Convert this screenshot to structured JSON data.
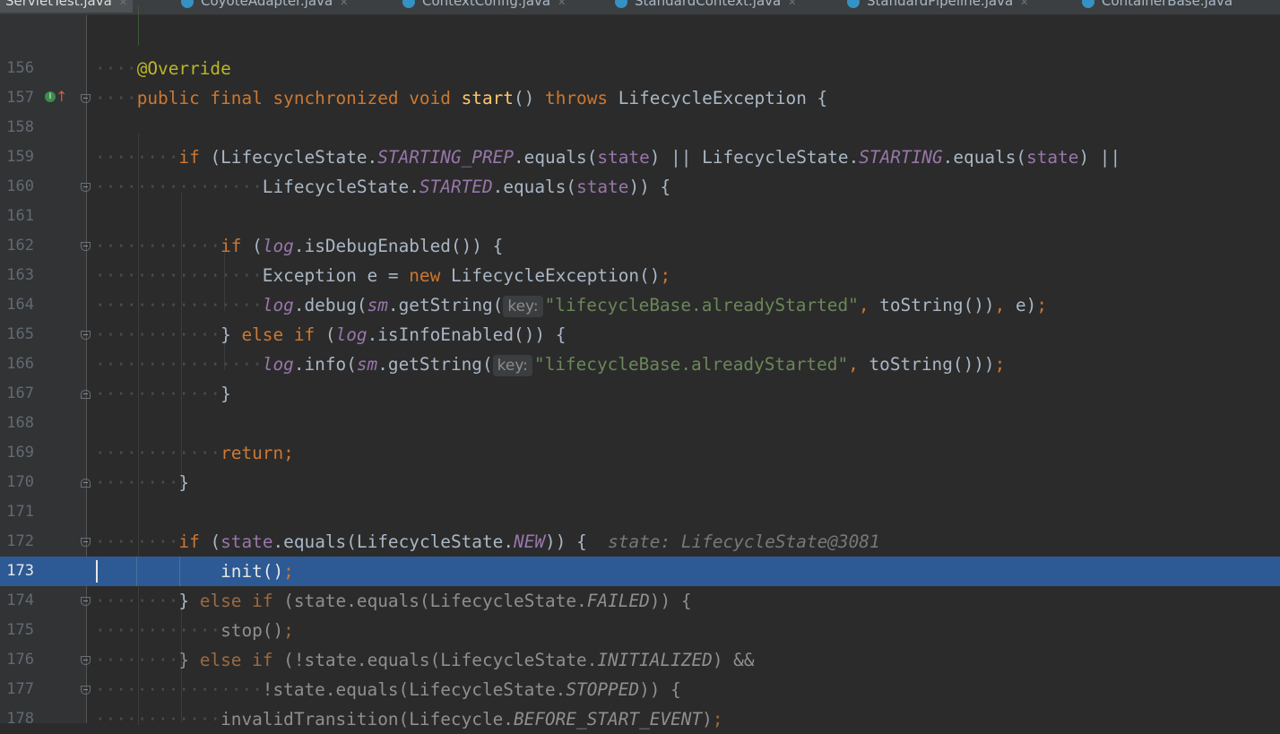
{
  "tabs": [
    {
      "label": "ServletTest.java",
      "active": true
    },
    {
      "label": "CoyoteAdapter.java",
      "active": false
    },
    {
      "label": "ContextConfig.java",
      "active": false
    },
    {
      "label": "StandardContext.java",
      "active": false
    },
    {
      "label": "StandardPipeline.java",
      "active": false
    },
    {
      "label": "ContainerBase.java",
      "active": false
    }
  ],
  "editor": {
    "current_line": "173",
    "lines": [
      {
        "num": "156",
        "text": "@Override"
      },
      {
        "num": "157",
        "text": "public final synchronized void start() throws LifecycleException {"
      },
      {
        "num": "158",
        "text": ""
      },
      {
        "num": "159",
        "text": "if (LifecycleState.STARTING_PREP.equals(state) || LifecycleState.STARTING.equals(state) ||"
      },
      {
        "num": "160",
        "text": "LifecycleState.STARTED.equals(state)) {"
      },
      {
        "num": "161",
        "text": ""
      },
      {
        "num": "162",
        "text": "if (log.isDebugEnabled()) {"
      },
      {
        "num": "163",
        "text": "Exception e = new LifecycleException();"
      },
      {
        "num": "164",
        "text": "log.debug(sm.getString(key: \"lifecycleBase.alreadyStarted\", toString()), e);"
      },
      {
        "num": "165",
        "text": "} else if (log.isInfoEnabled()) {"
      },
      {
        "num": "166",
        "text": "log.info(sm.getString(key: \"lifecycleBase.alreadyStarted\", toString()));"
      },
      {
        "num": "167",
        "text": "}"
      },
      {
        "num": "168",
        "text": ""
      },
      {
        "num": "169",
        "text": "return;"
      },
      {
        "num": "170",
        "text": "}"
      },
      {
        "num": "171",
        "text": ""
      },
      {
        "num": "172",
        "text": "if (state.equals(LifecycleState.NEW)) {"
      },
      {
        "num": "173",
        "text": "init();"
      },
      {
        "num": "174",
        "text": "} else if (state.equals(LifecycleState.FAILED)) {"
      },
      {
        "num": "175",
        "text": "stop();"
      },
      {
        "num": "176",
        "text": "} else if (!state.equals(LifecycleState.INITIALIZED) &&"
      },
      {
        "num": "177",
        "text": "!state.equals(LifecycleState.STOPPED)) {"
      },
      {
        "num": "178",
        "text": "invalidTransition(Lifecycle.BEFORE_START_EVENT);"
      }
    ],
    "param_hint": "key:",
    "debug_value": "state: LifecycleState@3081"
  },
  "colors": {
    "background": "#2b2b2b",
    "gutter": "#313335",
    "keyword": "#cc7832",
    "annotation": "#bbb529",
    "method_decl": "#ffc66d",
    "field": "#9876aa",
    "string": "#6a8759",
    "current_line": "#2d5a94"
  }
}
